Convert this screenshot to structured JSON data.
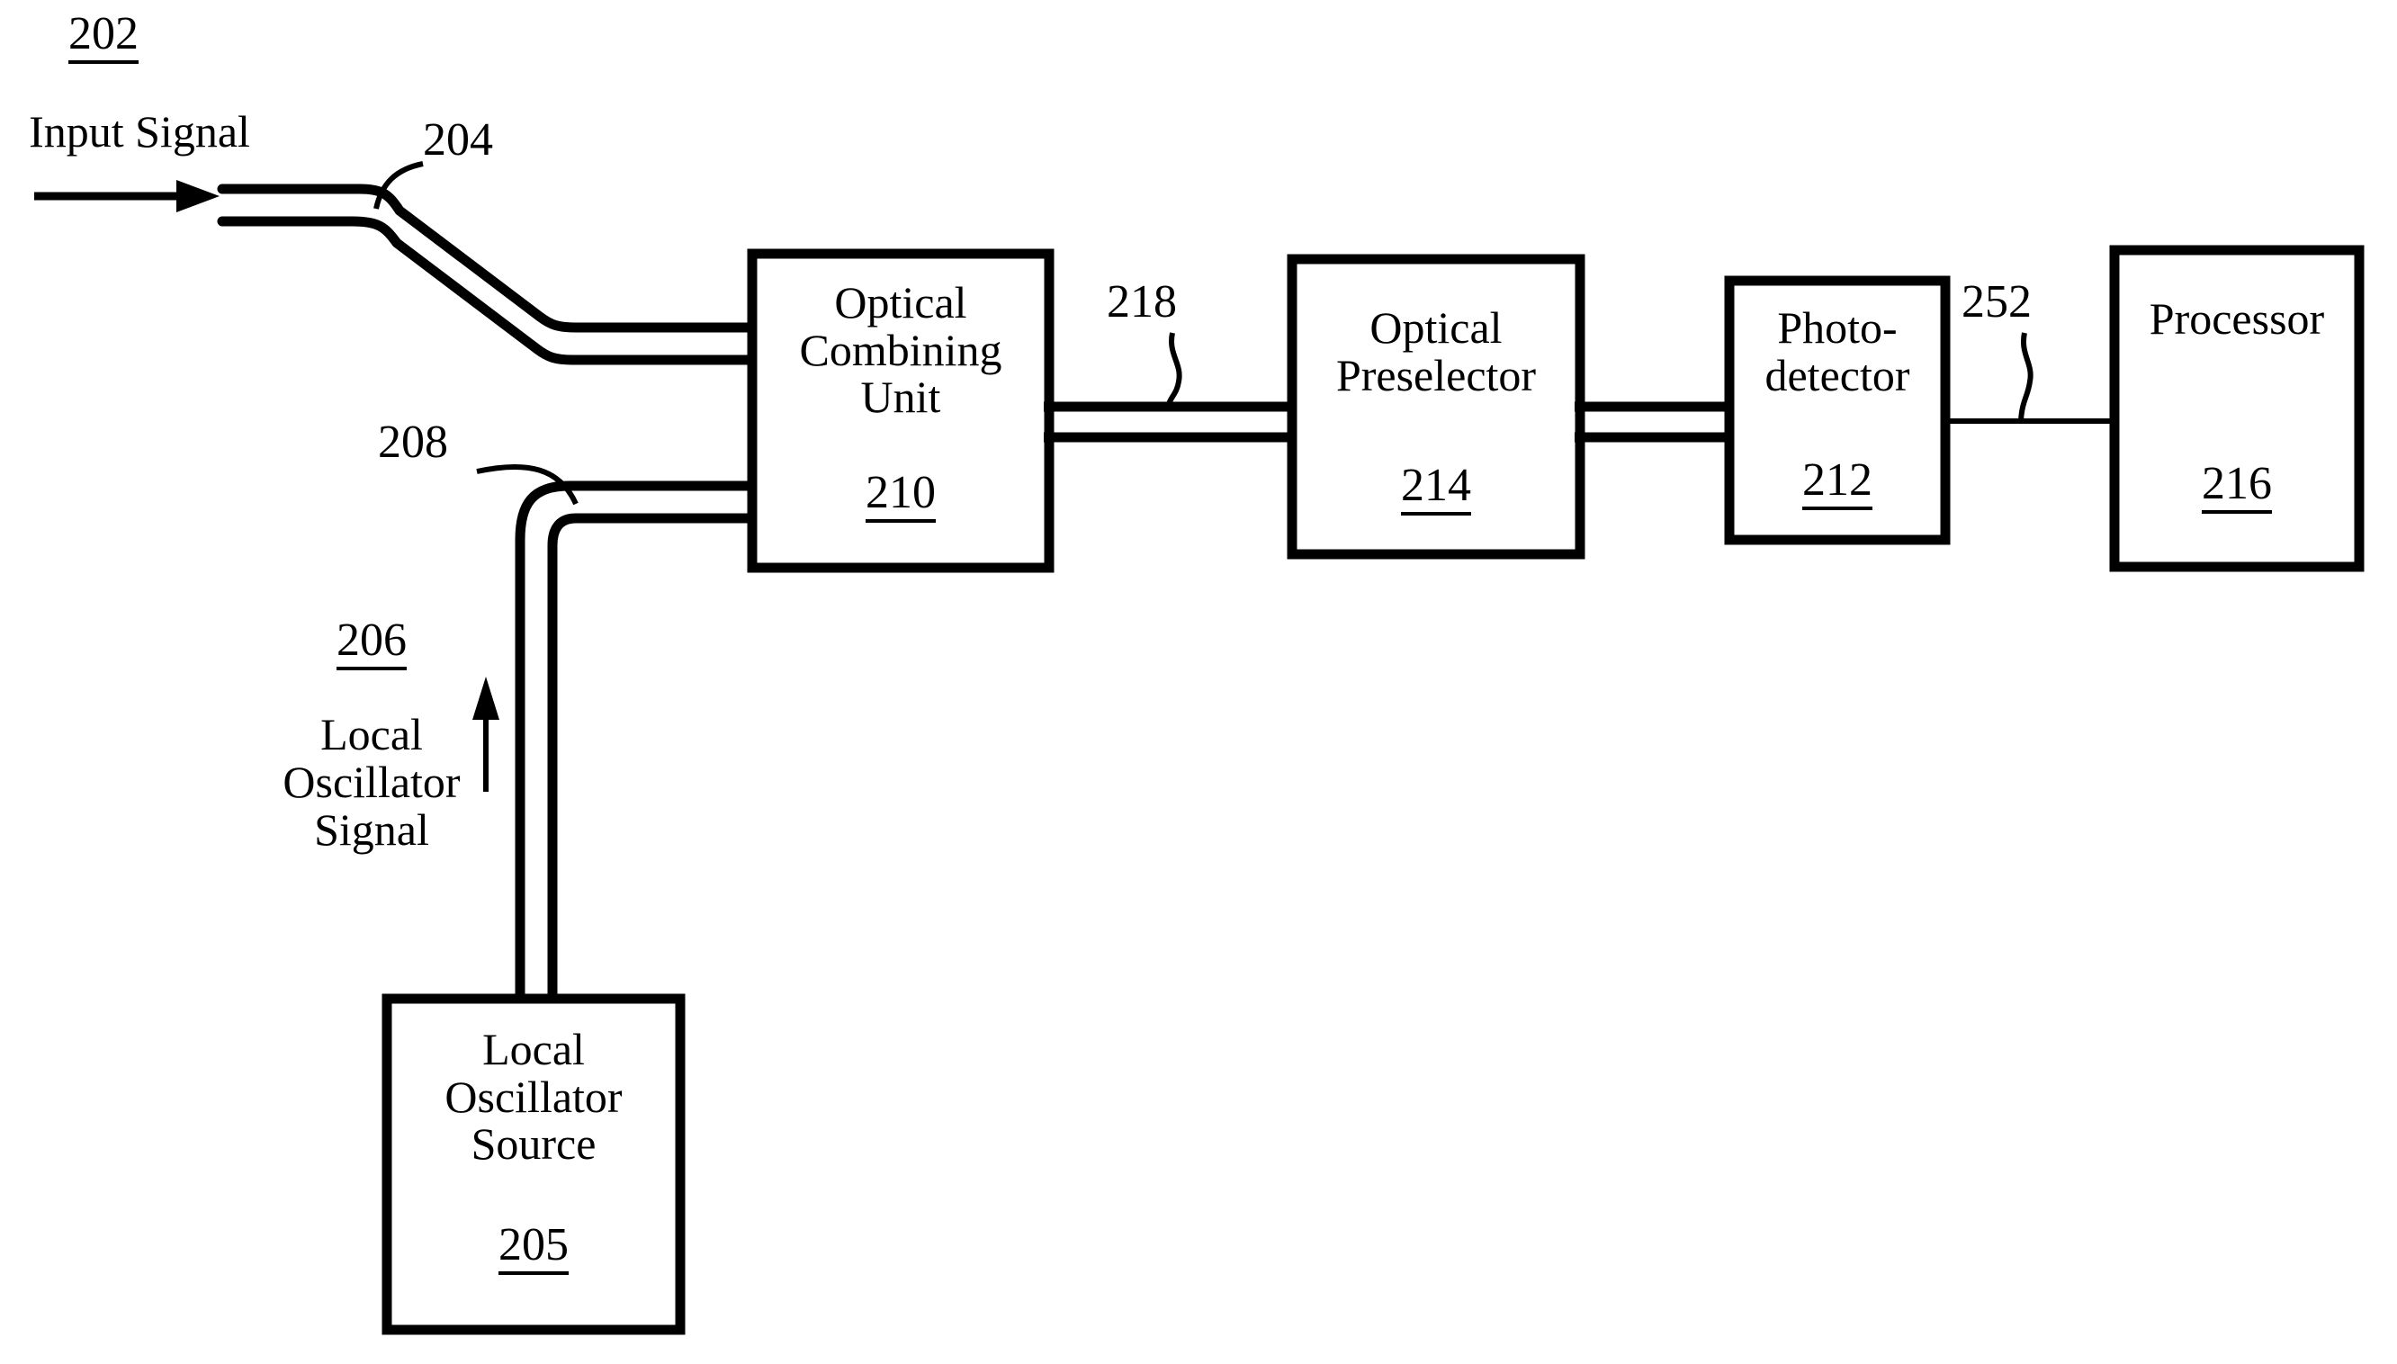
{
  "figure": {
    "type": "patent-block-diagram",
    "background_color": "#ffffff",
    "line_color": "#000000"
  },
  "signals": {
    "input": {
      "ref": "202",
      "label": "Input Signal"
    },
    "input_waveguide": {
      "ref": "204"
    },
    "local_oscillator": {
      "ref": "206",
      "label": "Local\nOscillator\nSignal"
    },
    "lo_waveguide": {
      "ref": "208"
    },
    "combined_waveguide": {
      "ref": "218"
    },
    "detector_output": {
      "ref": "252"
    }
  },
  "blocks": [
    {
      "id": "optical-combining-unit",
      "label": "Optical\nCombining\nUnit",
      "ref": "210"
    },
    {
      "id": "optical-preselector",
      "label": "Optical\nPreselector",
      "ref": "214"
    },
    {
      "id": "photodetector",
      "label": "Photo-\ndetector",
      "ref": "212"
    },
    {
      "id": "processor",
      "label": "Processor",
      "ref": "216"
    },
    {
      "id": "local-oscillator-source",
      "label": "Local\nOscillator\nSource",
      "ref": "205"
    }
  ]
}
